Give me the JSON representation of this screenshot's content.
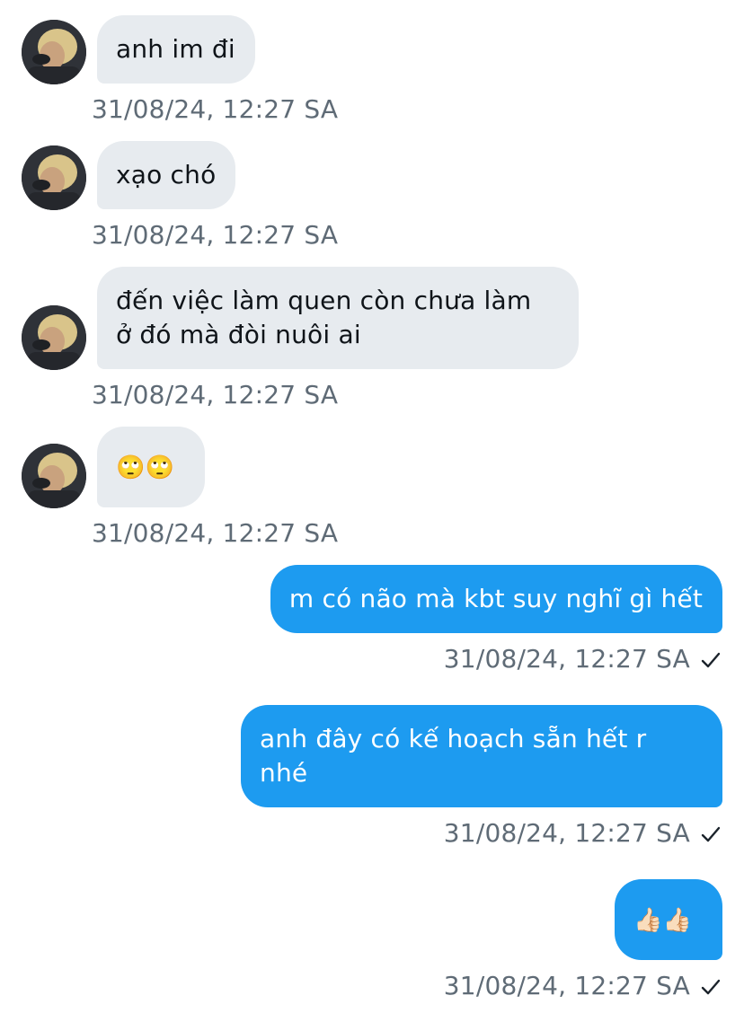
{
  "conversation": {
    "messages": [
      {
        "direction": "in",
        "text": "anh im đi",
        "timestamp": "31/08/24, 12:27 SA"
      },
      {
        "direction": "in",
        "text": "xạo chó",
        "timestamp": "31/08/24, 12:27 SA"
      },
      {
        "direction": "in",
        "text_line1": "đến việc làm quen còn chưa làm",
        "text_line2": "ở đó mà đòi nuôi ai",
        "timestamp": "31/08/24, 12:27 SA"
      },
      {
        "direction": "in",
        "text": "🙄🙄",
        "timestamp": "31/08/24, 12:27 SA"
      },
      {
        "direction": "out",
        "text": "m có não mà kbt suy nghĩ gì hết",
        "timestamp": "31/08/24, 12:27 SA",
        "status_icon": "check-icon"
      },
      {
        "direction": "out",
        "text_line1": "anh đây có kế hoạch sẵn hết r",
        "text_line2": "nhé",
        "timestamp": "31/08/24, 12:27 SA",
        "status_icon": "check-icon"
      },
      {
        "direction": "out",
        "text": "👍🏻👍🏻",
        "timestamp": "31/08/24, 12:27 SA",
        "status_icon": "check-icon"
      }
    ]
  },
  "colors": {
    "incoming_bubble": "#e7ebef",
    "outgoing_bubble": "#1d9bf0",
    "timestamp": "#5f6b76",
    "text_dark": "#0f1419"
  },
  "icons": {
    "avatar": "contact-avatar",
    "read_receipt": "check-icon"
  }
}
